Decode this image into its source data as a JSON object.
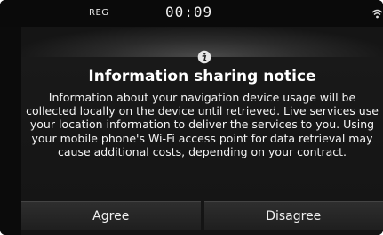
{
  "status_bar": {
    "reg_label": "REG",
    "time": "00:09",
    "wifi_icon": "wifi-icon"
  },
  "dialog": {
    "icon": "info-icon",
    "title": "Information sharing notice",
    "message": "Information about your navigation device usage will be collected locally on the device until retrieved. Live services use your location information to deliver the services to you. Using your mobile phone's Wi-Fi access point for data retrieval may cause additional costs, depending on your contract.",
    "buttons": {
      "agree_label": "Agree",
      "disagree_label": "Disagree"
    }
  },
  "colors": {
    "background": "#0b0b0b",
    "panel": "#1a1a1a",
    "text": "#ffffff"
  }
}
